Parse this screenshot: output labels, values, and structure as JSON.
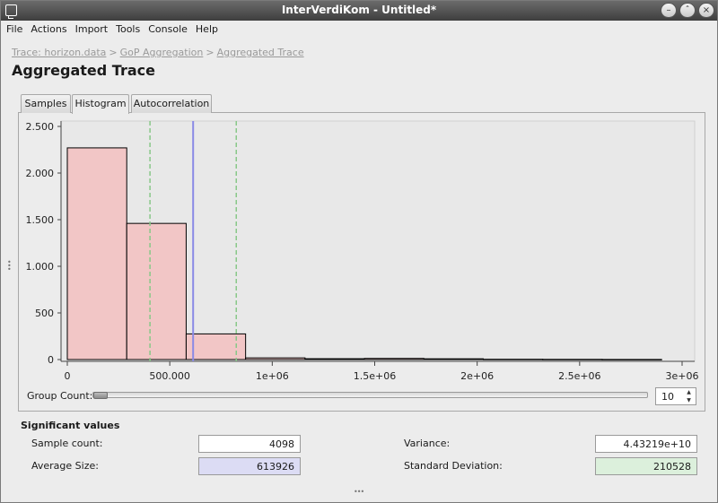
{
  "window": {
    "title": "InterVerdiKom - Untitled*"
  },
  "menu": [
    "File",
    "Actions",
    "Import",
    "Tools",
    "Console",
    "Help"
  ],
  "breadcrumb": {
    "items": [
      "Trace: horizon.data",
      "GoP Aggregation",
      "Aggregated Trace"
    ],
    "separator": ">"
  },
  "page_title": "Aggregated Trace",
  "tabs": [
    {
      "label": "Samples",
      "active": false
    },
    {
      "label": "Histogram",
      "active": true
    },
    {
      "label": "Autocorrelation",
      "active": false
    }
  ],
  "chart_data": {
    "type": "bar",
    "bin_edges": [
      0,
      290000,
      580000,
      870000,
      1160000,
      1450000,
      1740000,
      2030000,
      2320000,
      2610000,
      2900000
    ],
    "values": [
      2270,
      1460,
      275,
      18,
      9,
      12,
      8,
      3,
      2,
      1
    ],
    "xlim": [
      0,
      3000000
    ],
    "ylim": [
      0,
      2500
    ],
    "x_ticks": [
      {
        "value": 0,
        "label": "0"
      },
      {
        "value": 500000,
        "label": "500.000"
      },
      {
        "value": 1000000,
        "label": "1e+06"
      },
      {
        "value": 1500000,
        "label": "1.5e+06"
      },
      {
        "value": 2000000,
        "label": "2e+06"
      },
      {
        "value": 2500000,
        "label": "2.5e+06"
      },
      {
        "value": 3000000,
        "label": "3e+06"
      }
    ],
    "y_ticks": [
      {
        "value": 0,
        "label": "0"
      },
      {
        "value": 500,
        "label": "500"
      },
      {
        "value": 1000,
        "label": "1.000"
      },
      {
        "value": 1500,
        "label": "1.500"
      },
      {
        "value": 2000,
        "label": "2.000"
      },
      {
        "value": 2500,
        "label": "2.500"
      }
    ],
    "mean_line": 613926,
    "std_lines": [
      403398,
      824454
    ],
    "colors": {
      "bar_fill": "#f2c6c6",
      "bar_stroke": "#000000",
      "mean_line": "#8a8ae6",
      "std_line": "#88c888",
      "plot_bg": "#e8e8e8"
    }
  },
  "group_count": {
    "label": "Group Count:",
    "value": "10",
    "slider_fraction": 0.0
  },
  "significant": {
    "title": "Significant values",
    "sample_count": {
      "label": "Sample count:",
      "value": "4098"
    },
    "average_size": {
      "label": "Average Size:",
      "value": "613926",
      "color": "#dcdcf4"
    },
    "variance": {
      "label": "Variance:",
      "value": "4.43219e+10"
    },
    "std_dev": {
      "label": "Standard Deviation:",
      "value": "210528",
      "color": "#dcf0dc"
    }
  }
}
